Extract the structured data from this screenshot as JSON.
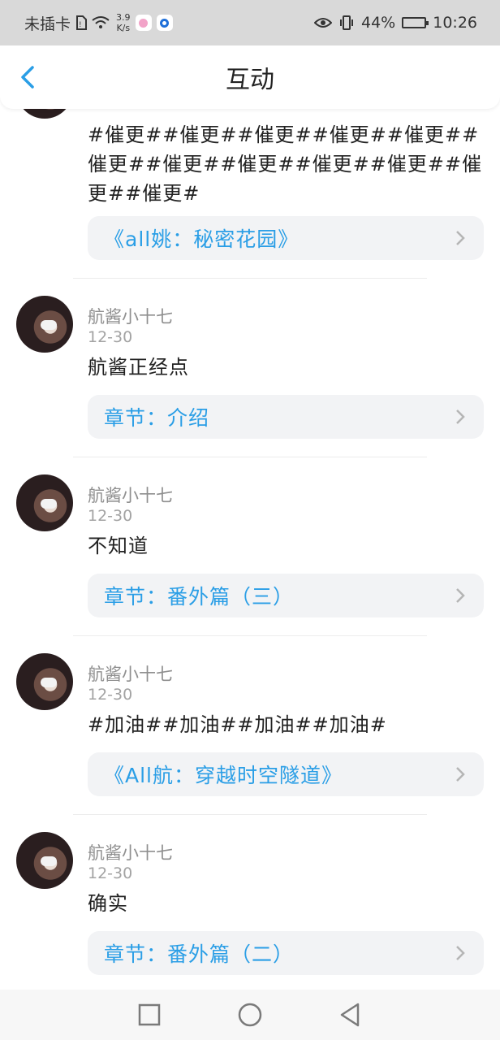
{
  "status_bar": {
    "carrier": "未插卡",
    "speed_value": "3.9",
    "speed_unit": "K/s",
    "battery": "44%",
    "time": "10:26"
  },
  "header": {
    "title": "互动"
  },
  "comments": [
    {
      "text": "#催更##催更##催更##催更##催更##催更##催更##催更##催更##催更##催更##催更#",
      "link": "《all姚：秘密花园》"
    },
    {
      "author": "航酱小十七",
      "date": "12-30",
      "text": "航酱正经点",
      "link": "章节：介绍"
    },
    {
      "author": "航酱小十七",
      "date": "12-30",
      "text": "不知道",
      "link": "章节：番外篇（三）"
    },
    {
      "author": "航酱小十七",
      "date": "12-30",
      "text": "#加油##加油##加油##加油#",
      "link": "《All航：穿越时空隧道》"
    },
    {
      "author": "航酱小十七",
      "date": "12-30",
      "text": "确实",
      "link": "章节：番外篇（二）"
    }
  ],
  "colors": {
    "accent": "#2a9ee6",
    "status_bar_bg": "#d9d9d9",
    "card_bg": "#f2f3f5"
  },
  "icons": [
    "back-arrow-icon",
    "chevron-right-icon",
    "square-nav-icon",
    "circle-nav-icon",
    "triangle-back-nav-icon"
  ]
}
